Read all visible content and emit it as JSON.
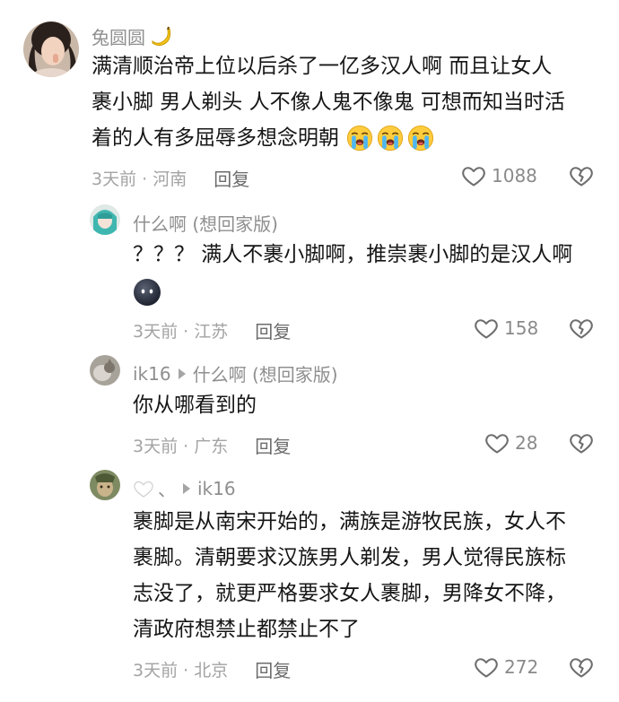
{
  "comments": [
    {
      "user": "兔圆圆",
      "user_badge_icon": "banana-icon",
      "lines": [
        "满清顺治帝上位以后杀了一亿多汉人啊  而且让女人",
        "裹小脚 男人剃头 人不像人鬼不像鬼 可想而知当时活",
        "着的人有多屈辱多想念明朝"
      ],
      "trailing_emojis": [
        "crying-face-icon",
        "crying-face-icon",
        "crying-face-icon"
      ],
      "time_location": "3天前 · 河南",
      "reply_label": "回复",
      "likes": "1088"
    },
    {
      "user": "什么啊 (想回家版)",
      "lines": [
        "？？？ 满人不裹小脚啊，推崇裹小脚的是汉人啊"
      ],
      "emoji_line": "dark-round-face-icon",
      "time_location": "3天前 · 江苏",
      "reply_label": "回复",
      "likes": "158"
    },
    {
      "user": "ik16",
      "reply_to": "什么啊 (想回家版)",
      "lines": [
        "你从哪看到的"
      ],
      "time_location": "3天前 · 广东",
      "reply_label": "回复",
      "likes": "28"
    },
    {
      "user": "、",
      "user_prefix_icon": "white-heart-icon",
      "reply_to": "ik16",
      "lines": [
        "裹脚是从南宋开始的，满族是游牧民族，女人不",
        "裹脚。清朝要求汉族男人剃发，男人觉得民族标",
        "志没了，就更严格要求女人裹脚，男降女不降，",
        "清政府想禁止都禁止不了"
      ],
      "time_location": "3天前 · 北京",
      "reply_label": "回复",
      "likes": "272"
    }
  ],
  "colors": {
    "text": "#161616",
    "muted": "#a3a3a3",
    "username": "#8f8f8f",
    "reply": "#6b6b6b"
  }
}
